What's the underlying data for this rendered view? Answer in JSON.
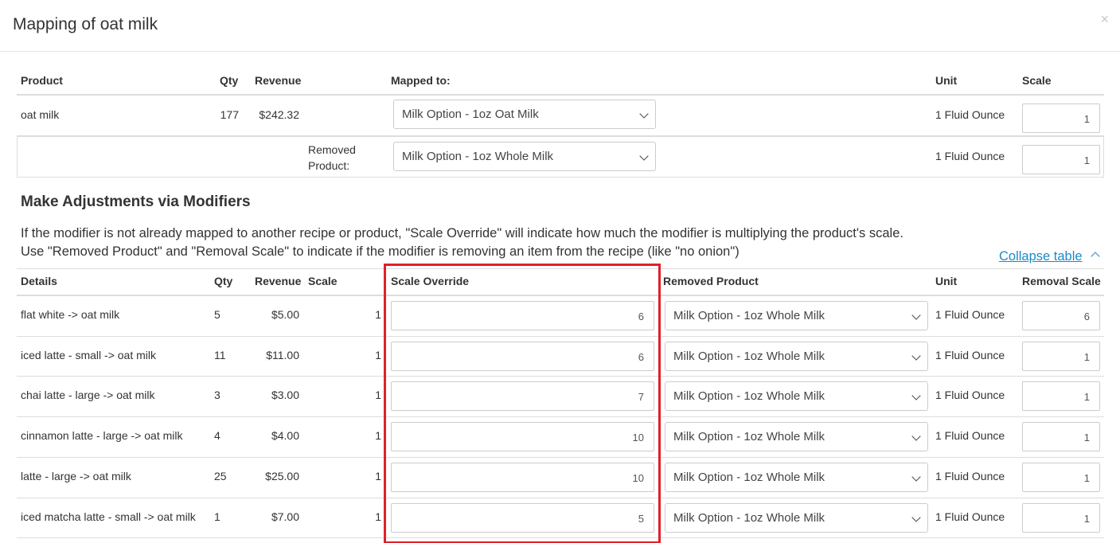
{
  "modal": {
    "title": "Mapping of oat milk",
    "close": "×"
  },
  "top_table": {
    "headers": {
      "product": "Product",
      "qty": "Qty",
      "revenue": "Revenue",
      "mapped_to": "Mapped to:",
      "unit": "Unit",
      "scale": "Scale"
    },
    "row": {
      "product": "oat milk",
      "qty": "177",
      "revenue": "$242.32",
      "mapped_to": "Milk Option - 1oz Oat Milk",
      "unit": "1 Fluid Ounce",
      "scale": "1"
    },
    "removed_row": {
      "label_line1": "Removed",
      "label_line2": "Product:",
      "mapped_to": "Milk Option - 1oz Whole Milk",
      "unit": "1 Fluid Ounce",
      "scale": "1"
    }
  },
  "modifiers": {
    "title": "Make Adjustments via Modifiers",
    "description": "If the modifier is not already mapped to another recipe or product, \"Scale Override\" will indicate how much the modifier is multiplying the product's scale. Use \"Removed Product\" and \"Removal Scale\" to indicate if the modifier is removing an item from the recipe (like \"no onion\")",
    "collapse_label": "Collapse table",
    "headers": {
      "details": "Details",
      "qty": "Qty",
      "revenue": "Revenue",
      "scale": "Scale",
      "scale_override": "Scale Override",
      "removed_product": "Removed Product",
      "unit": "Unit",
      "removal_scale": "Removal Scale"
    },
    "rows": [
      {
        "details": "flat white -> oat milk",
        "qty": "5",
        "revenue": "$5.00",
        "scale": "1",
        "scale_override": "6",
        "removed_product": "Milk Option - 1oz Whole Milk",
        "unit": "1 Fluid Ounce",
        "removal_scale": "6"
      },
      {
        "details": "iced latte - small -> oat milk",
        "qty": "11",
        "revenue": "$11.00",
        "scale": "1",
        "scale_override": "6",
        "removed_product": "Milk Option - 1oz Whole Milk",
        "unit": "1 Fluid Ounce",
        "removal_scale": "1"
      },
      {
        "details": "chai latte - large -> oat milk",
        "qty": "3",
        "revenue": "$3.00",
        "scale": "1",
        "scale_override": "7",
        "removed_product": "Milk Option - 1oz Whole Milk",
        "unit": "1 Fluid Ounce",
        "removal_scale": "1"
      },
      {
        "details": "cinnamon latte - large -> oat milk",
        "qty": "4",
        "revenue": "$4.00",
        "scale": "1",
        "scale_override": "10",
        "removed_product": "Milk Option - 1oz Whole Milk",
        "unit": "1 Fluid Ounce",
        "removal_scale": "1"
      },
      {
        "details": "latte - large -> oat milk",
        "qty": "25",
        "revenue": "$25.00",
        "scale": "1",
        "scale_override": "10",
        "removed_product": "Milk Option - 1oz Whole Milk",
        "unit": "1 Fluid Ounce",
        "removal_scale": "1"
      },
      {
        "details": "iced matcha latte - small -> oat milk",
        "qty": "1",
        "revenue": "$7.00",
        "scale": "1",
        "scale_override": "5",
        "removed_product": "Milk Option - 1oz Whole Milk",
        "unit": "1 Fluid Ounce",
        "removal_scale": "1"
      }
    ]
  },
  "colors": {
    "highlight": "#e0202a",
    "link": "#1a8ac7",
    "border": "#dddddd"
  }
}
